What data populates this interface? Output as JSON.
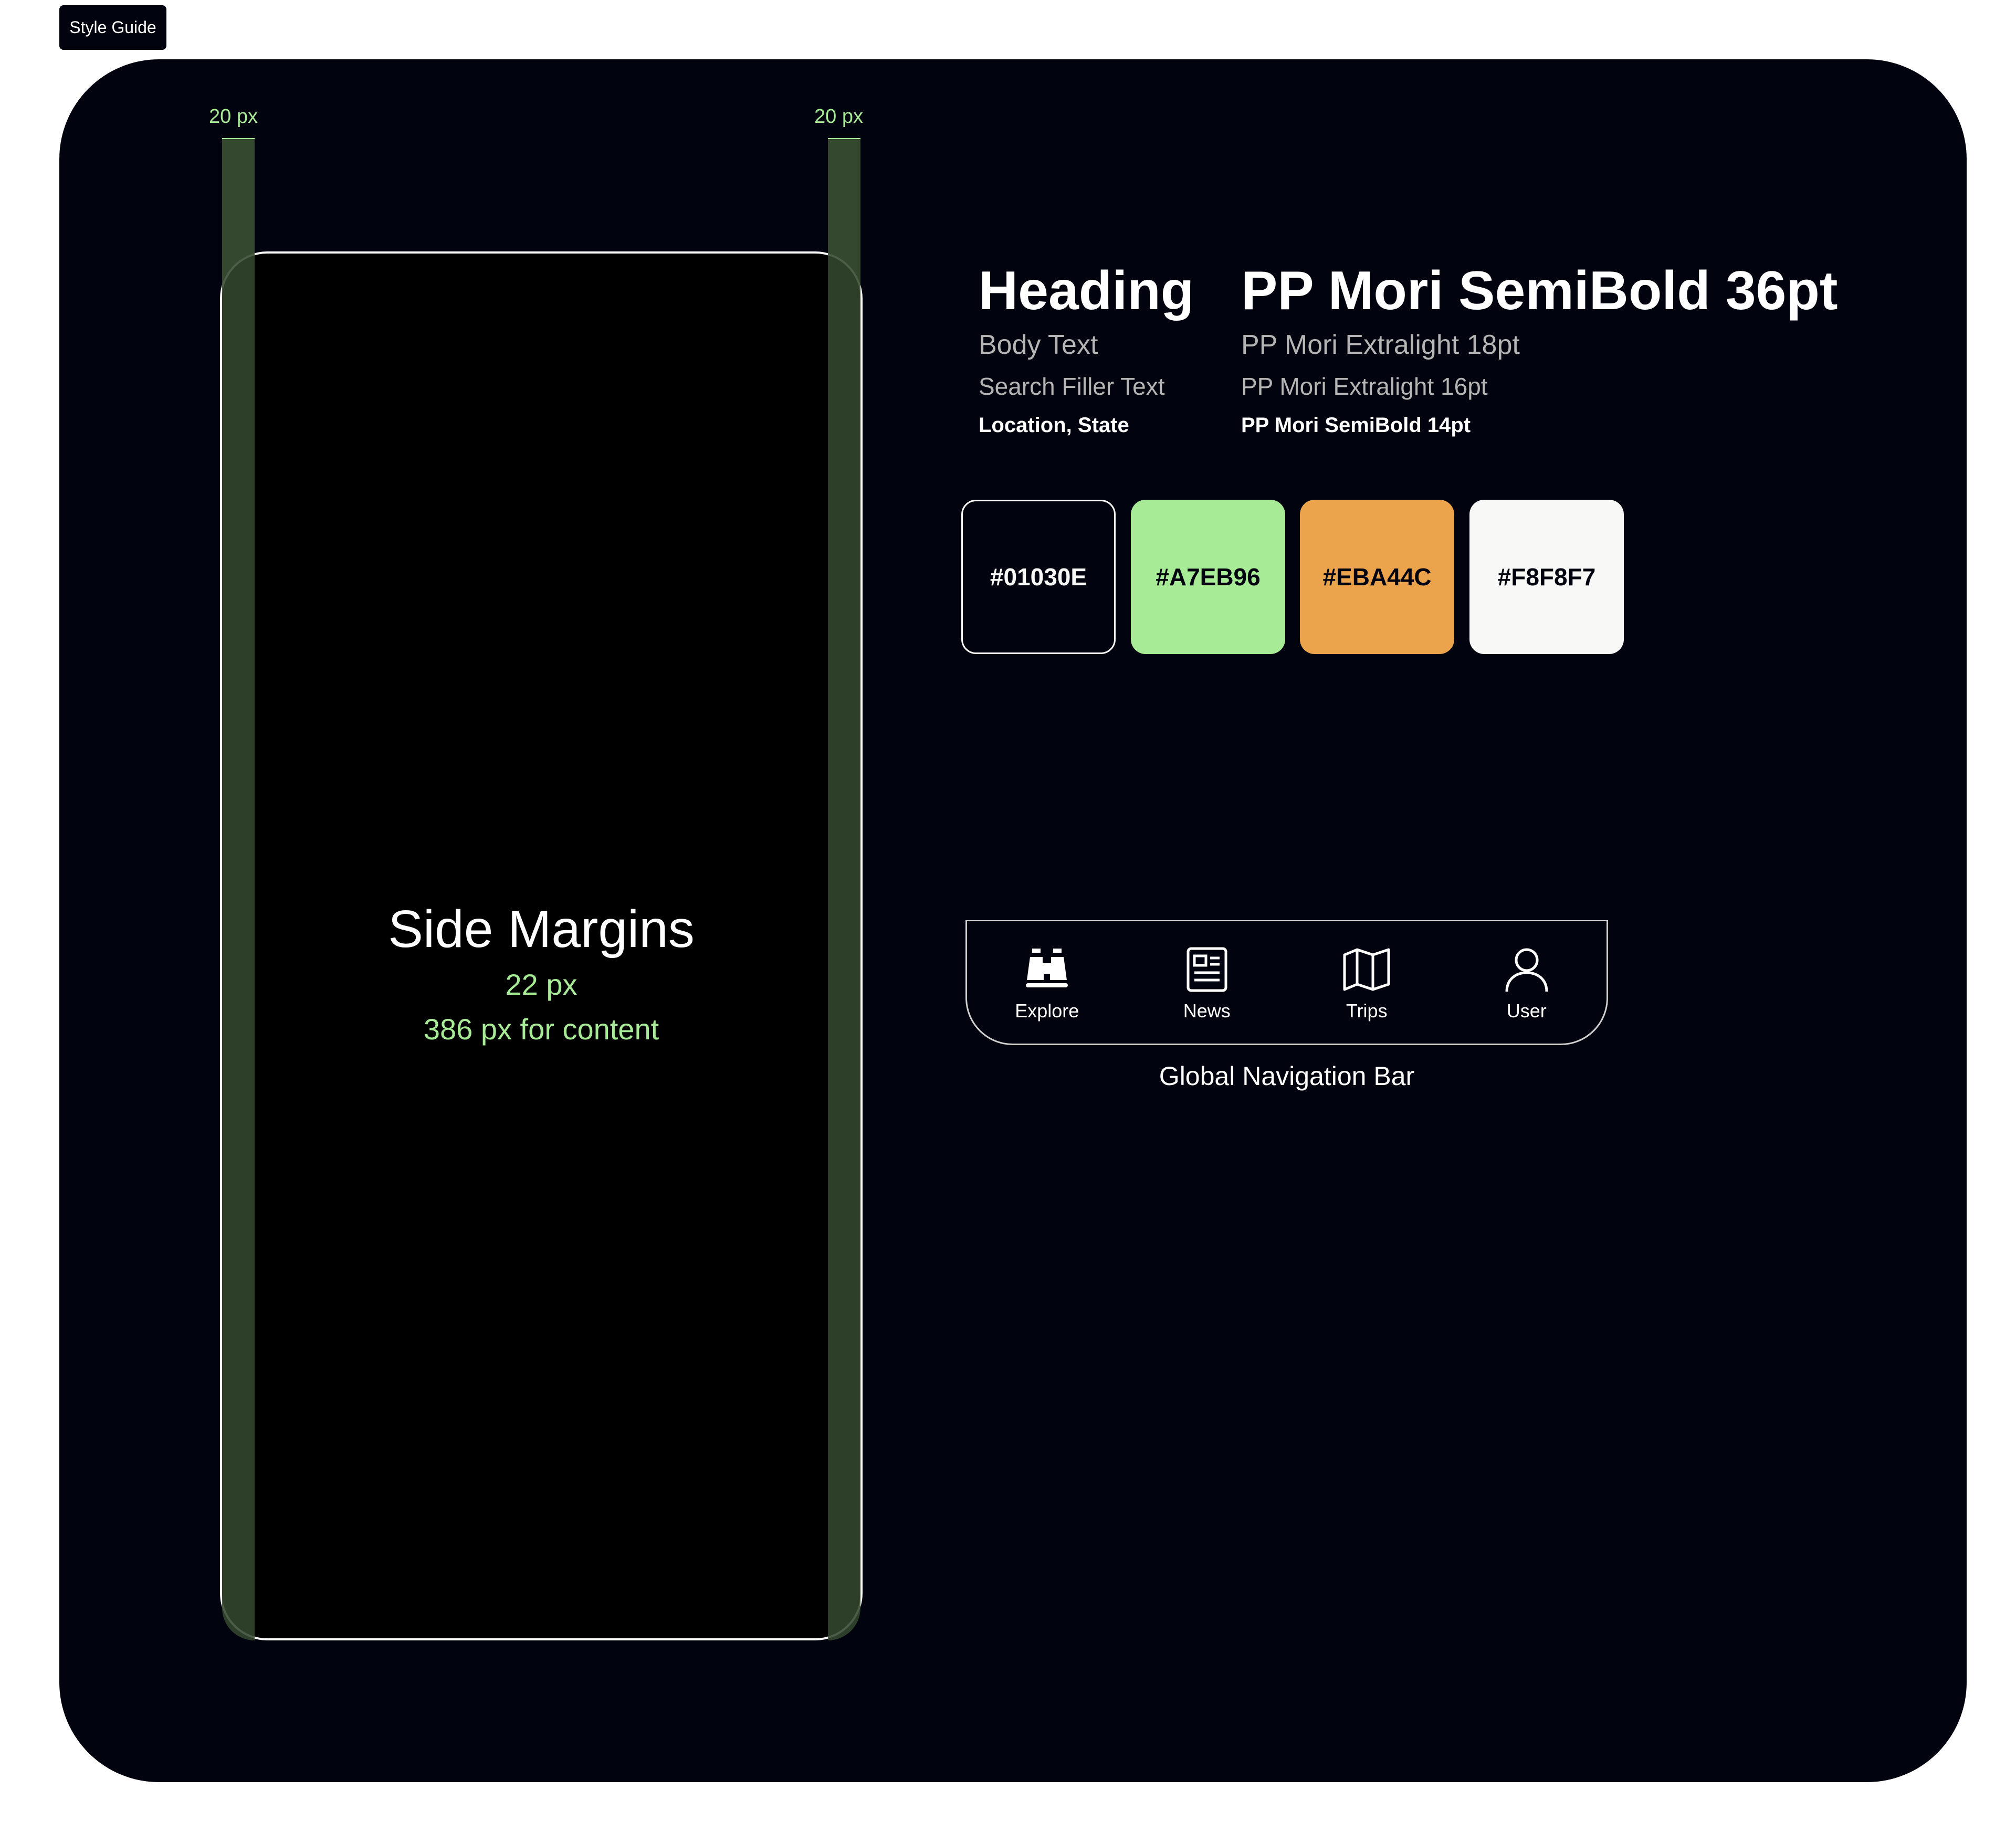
{
  "frame_label": "Style Guide",
  "margins": {
    "left_label": "20 px",
    "right_label": "20 px",
    "title": "Side Margins",
    "value": "22 px",
    "content": "386 px for content"
  },
  "typography": [
    {
      "sample": "Heading",
      "spec": "PP Mori SemiBold 36pt"
    },
    {
      "sample": "Body Text",
      "spec": "PP Mori Extralight 18pt"
    },
    {
      "sample": "Search Filler Text",
      "spec": "PP Mori Extralight 16pt"
    },
    {
      "sample": "Location, State",
      "spec": "PP Mori SemiBold 14pt"
    }
  ],
  "swatches": [
    {
      "label": "#01030E",
      "color": "#01030E"
    },
    {
      "label": "#A7EB96",
      "color": "#A7EB96"
    },
    {
      "label": "#EBA44C",
      "color": "#EBA44C"
    },
    {
      "label": "#F8F8F7",
      "color": "#F8F8F7"
    }
  ],
  "nav": {
    "items": [
      {
        "label": "Explore",
        "icon": "binoculars-icon"
      },
      {
        "label": "News",
        "icon": "newspaper-icon"
      },
      {
        "label": "Trips",
        "icon": "map-icon"
      },
      {
        "label": "User",
        "icon": "user-icon"
      }
    ],
    "caption": "Global Navigation Bar"
  }
}
